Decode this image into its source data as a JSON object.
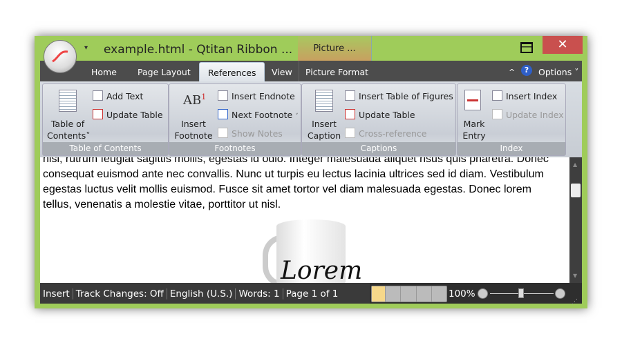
{
  "window": {
    "title": "example.html - Qtitan Ribbon ...",
    "context_tab": "Picture ...",
    "minimize": "—",
    "maximize": "☐",
    "close": "✕"
  },
  "tabs": [
    {
      "label": "Home"
    },
    {
      "label": "Page Layout"
    },
    {
      "label": "References",
      "active": true
    },
    {
      "label": "View"
    },
    {
      "label": "Picture Format"
    }
  ],
  "tabbar_right": {
    "collapse": "^",
    "help": "?",
    "options": "Options ˅"
  },
  "groups": {
    "toc": {
      "label": "Table of Contents",
      "big_line1": "Table of",
      "big_line2": "Contents˅",
      "add_text": "Add Text",
      "update_table": "Update Table"
    },
    "footnotes": {
      "label": "Footnotes",
      "big_icon": "AB",
      "big_sup": "1",
      "big_line1": "Insert",
      "big_line2": "Footnote",
      "insert_endnote": "Insert Endnote",
      "next_footnote": "Next Footnote",
      "next_arrow": "˅",
      "show_notes": "Show Notes"
    },
    "captions": {
      "label": "Captions",
      "big_line1": "Insert",
      "big_line2": "Caption",
      "insert_tof": "Insert Table of Figures",
      "update_table": "Update Table",
      "cross_reference": "Cross-reference"
    },
    "index": {
      "label": "Index",
      "big_line1": "Mark",
      "big_line2": "Entry",
      "insert_index": "Insert Index",
      "update_index": "Update Index"
    }
  },
  "document": {
    "text": "nisl, rutrum feugiat sagittis mollis, egestas id odio. Integer malesuada aliquet risus quis pharetra. Donec consequat euismod ante nec convallis. Nunc ut turpis eu lectus lacinia ultrices sed id diam. Vestibulum egestas luctus velit mollis euismod. Fusce sit amet tortor vel diam malesuada egestas. Donec lorem tellus, venenatis a molestie vitae, porttitor ut nisl.",
    "mug_text": "Lorem"
  },
  "status": {
    "mode": "Insert",
    "track": "Track Changes: Off",
    "lang": "English (U.S.)",
    "words": "Words: 1",
    "page": "Page 1 of 1",
    "zoom": "100%",
    "zoom_percent": 100
  },
  "colors": {
    "frame": "#9fcc5a",
    "close": "#c9504e",
    "tabbar": "#4c4c4c"
  }
}
